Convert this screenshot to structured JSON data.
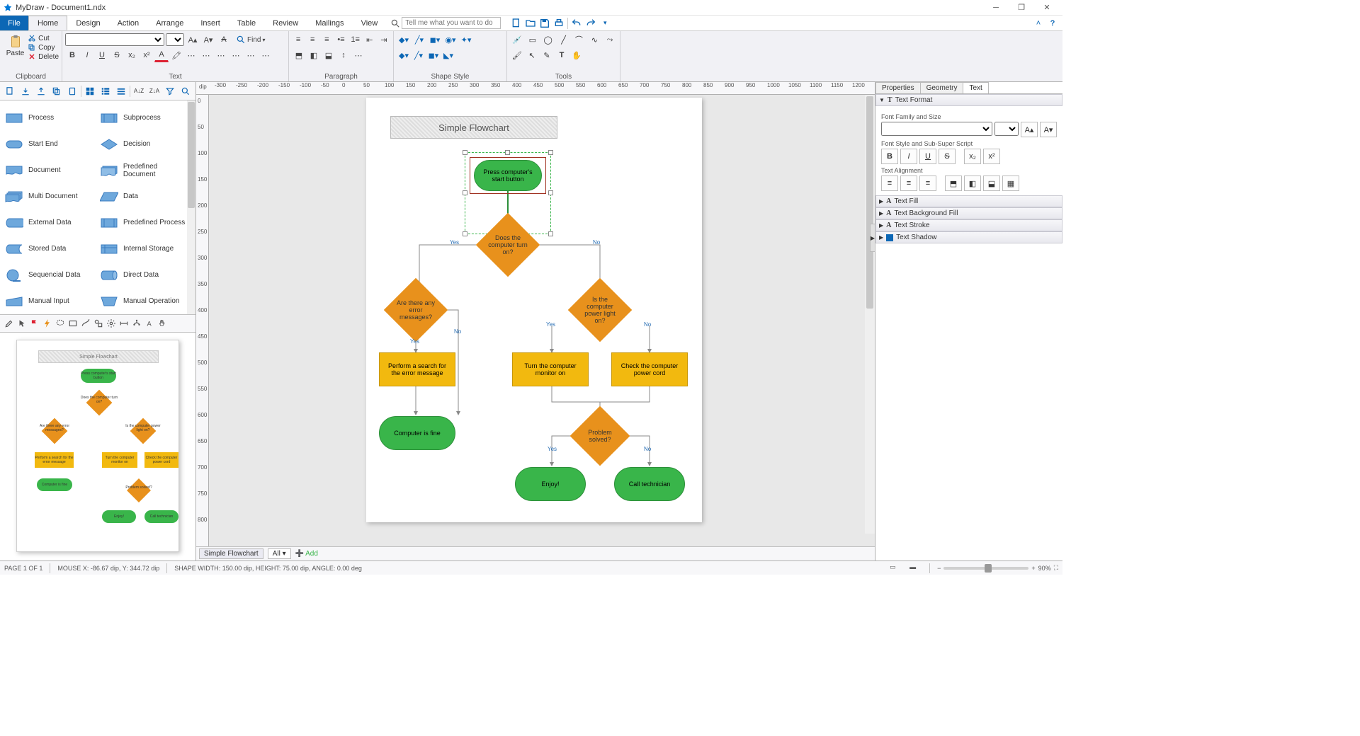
{
  "title": "MyDraw - Document1.ndx",
  "ribbon_tabs": {
    "file": "File",
    "home": "Home",
    "design": "Design",
    "action": "Action",
    "arrange": "Arrange",
    "insert": "Insert",
    "table": "Table",
    "review": "Review",
    "mailings": "Mailings",
    "view": "View"
  },
  "search_placeholder": "Tell me what you want to do",
  "clipboard": {
    "paste": "Paste",
    "cut": "Cut",
    "copy": "Copy",
    "delete": "Delete",
    "group": "Clipboard"
  },
  "text_group": "Text",
  "para_group": "Paragraph",
  "shapestyle_group": "Shape Style",
  "tools_group": "Tools",
  "find": "Find",
  "shapes_palette": [
    {
      "l": "Process",
      "r": "Subprocess"
    },
    {
      "l": "Start End",
      "r": "Decision"
    },
    {
      "l": "Document",
      "r": "Predefined Document"
    },
    {
      "l": "Multi Document",
      "r": "Data"
    },
    {
      "l": "External Data",
      "r": "Predefined Process"
    },
    {
      "l": "Stored Data",
      "r": "Internal Storage"
    },
    {
      "l": "Sequencial Data",
      "r": "Direct Data"
    },
    {
      "l": "Manual Input",
      "r": "Manual Operation"
    }
  ],
  "flowchart": {
    "title": "Simple Flowchart",
    "n1": "Press computer's\nstart button",
    "d1": "Does the\ncomputer turn\non?",
    "d2": "Are there any\nerror messages?",
    "d3": "Is the computer\npower light on?",
    "p1": "Perform a search for\nthe error message",
    "p2": "Turn the computer\nmonitor on",
    "p3": "Check the computer\npower cord",
    "t1": "Computer is fine",
    "d4": "Problem solved?",
    "t2": "Enjoy!",
    "t3": "Call technician",
    "yes": "Yes",
    "no": "No"
  },
  "sheets": {
    "s1": "Simple Flowchart",
    "all": "All",
    "add": "Add"
  },
  "rightpanel": {
    "tabs": {
      "props": "Properties",
      "geom": "Geometry",
      "text": "Text"
    },
    "text_format": "Text Format",
    "font_family_size": "Font Family and Size",
    "font_style": "Font Style and Sub-Super Script",
    "text_align": "Text Alignment",
    "text_fill": "Text Fill",
    "text_bg": "Text Background Fill",
    "text_stroke": "Text Stroke",
    "text_shadow": "Text Shadow"
  },
  "status": {
    "page": "PAGE 1 OF 1",
    "mouse": "MOUSE X: -86.67 dip, Y: 344.72 dip",
    "shape": "SHAPE WIDTH: 150.00 dip, HEIGHT: 75.00 dip, ANGLE: 0.00 deg",
    "zoom": "90%"
  },
  "hruler_ticks": [
    "-300",
    "-250",
    "-200",
    "-150",
    "-100",
    "-50",
    "0",
    "50",
    "100",
    "150",
    "200",
    "250",
    "300",
    "350",
    "400",
    "450",
    "500",
    "550",
    "600",
    "650",
    "700",
    "750",
    "800",
    "850",
    "900",
    "950",
    "1000",
    "1050",
    "1100",
    "1150",
    "1200"
  ],
  "vruler_ticks": [
    "0",
    "50",
    "100",
    "150",
    "200",
    "250",
    "300",
    "350",
    "400",
    "450",
    "500",
    "550",
    "600",
    "650",
    "700",
    "750",
    "800"
  ],
  "ruler_unit": "dip"
}
